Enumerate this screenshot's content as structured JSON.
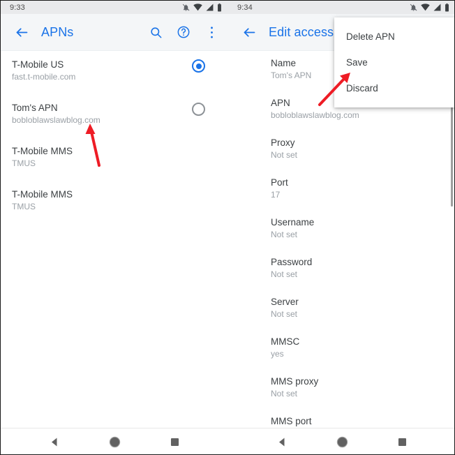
{
  "left_screen": {
    "status_bar": {
      "time": "9:33",
      "icons": [
        "notifications-off-icon",
        "wifi-icon",
        "signal-icon",
        "battery-icon"
      ]
    },
    "toolbar": {
      "back_icon": "arrow-back-icon",
      "title": "APNs",
      "actions": [
        {
          "name": "search-icon",
          "label": "Search"
        },
        {
          "name": "help-icon",
          "label": "Help"
        },
        {
          "name": "more-options-icon",
          "label": "More options"
        }
      ]
    },
    "apn_list": [
      {
        "title": "T-Mobile US",
        "subtitle": "fast.t-mobile.com",
        "selected": true
      },
      {
        "title": "Tom's APN",
        "subtitle": "bobloblawslawblog.com",
        "selected": false
      },
      {
        "title": "T-Mobile MMS",
        "subtitle": "TMUS",
        "selected": null
      },
      {
        "title": "T-Mobile MMS",
        "subtitle": "TMUS",
        "selected": null
      }
    ]
  },
  "right_screen": {
    "status_bar": {
      "time": "9:34",
      "icons": [
        "notifications-off-icon",
        "wifi-icon",
        "signal-icon",
        "battery-icon"
      ]
    },
    "toolbar": {
      "back_icon": "arrow-back-icon",
      "title": "Edit access point"
    },
    "overflow_menu": {
      "visible": true,
      "items": [
        {
          "label": "Delete APN"
        },
        {
          "label": "Save"
        },
        {
          "label": "Discard"
        }
      ]
    },
    "settings": [
      {
        "label": "Name",
        "value": "Tom's APN"
      },
      {
        "label": "APN",
        "value": "bobloblawslawblog.com"
      },
      {
        "label": "Proxy",
        "value": "Not set"
      },
      {
        "label": "Port",
        "value": "17"
      },
      {
        "label": "Username",
        "value": "Not set"
      },
      {
        "label": "Password",
        "value": "Not set"
      },
      {
        "label": "Server",
        "value": "Not set"
      },
      {
        "label": "MMSC",
        "value": "yes"
      },
      {
        "label": "MMS proxy",
        "value": "Not set"
      },
      {
        "label": "MMS port",
        "value": ""
      }
    ]
  },
  "nav_bar": {
    "buttons": [
      {
        "name": "back-nav-icon",
        "label": "Back"
      },
      {
        "name": "home-nav-icon",
        "label": "Home"
      },
      {
        "name": "recents-nav-icon",
        "label": "Recents"
      }
    ]
  },
  "annotations": {
    "arrow_color": "#ee1c25",
    "arrows": [
      {
        "name": "arrow-pointing-to-toms-apn"
      },
      {
        "name": "arrow-pointing-to-save"
      }
    ]
  },
  "colors": {
    "accent": "#1a73e8",
    "toolbar_bg": "#f4f6f8",
    "status_bg": "#e9eaec",
    "primary_text": "#3c4043",
    "secondary_text": "#9aa0a6"
  }
}
